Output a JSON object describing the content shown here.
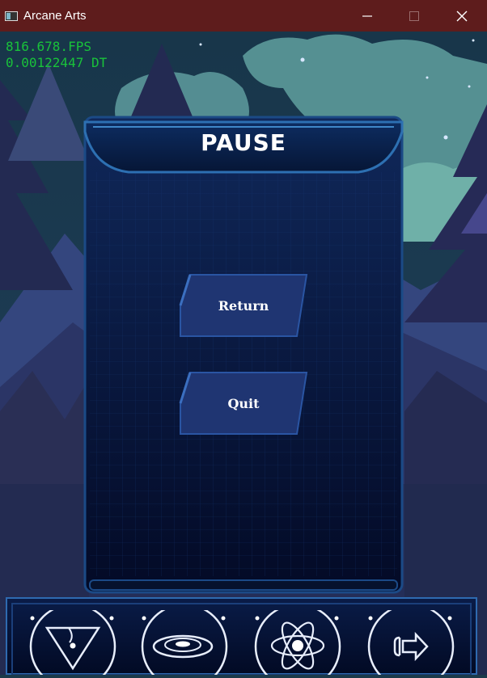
{
  "window": {
    "title": "Arcane Arts",
    "minimize_icon": "minimize-icon",
    "maximize_icon": "maximize-icon",
    "close_icon": "close-icon"
  },
  "hud": {
    "fps": "816.678.FPS",
    "dt": "0.00122447 DT"
  },
  "pause_menu": {
    "title": "PAUSE",
    "buttons": [
      {
        "label": "Return"
      },
      {
        "label": "Quit"
      }
    ]
  },
  "dock": {
    "items": [
      {
        "icon": "rune-triangle-icon"
      },
      {
        "icon": "galaxy-icon"
      },
      {
        "icon": "atom-icon"
      },
      {
        "icon": "exit-arrow-icon"
      }
    ]
  },
  "colors": {
    "titlebar": "#5e1c1c",
    "hud_text": "#19c23a",
    "panel": "#0b1a3e",
    "panel_border": "#1f4f8a",
    "button": "#1f3572",
    "sky": "#1a3b4f",
    "mountain": "#3a4d8a",
    "tree": "#2a2f5c"
  }
}
